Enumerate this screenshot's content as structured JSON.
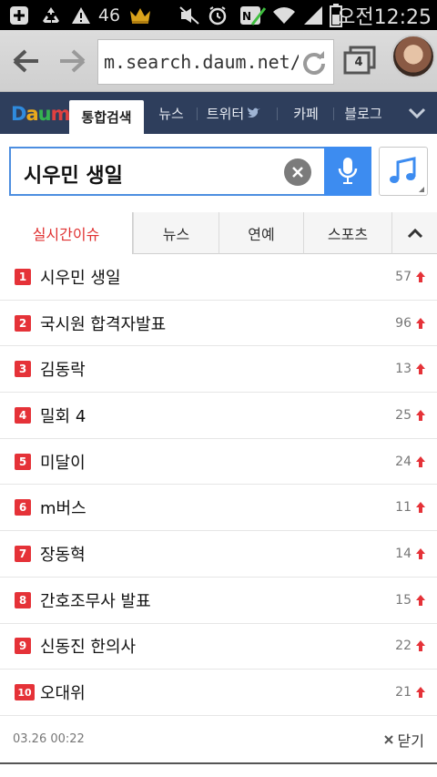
{
  "status_bar": {
    "signal_number": "46",
    "time": "오전12:25"
  },
  "browser": {
    "url": "m.search.daum.net/se",
    "tab_count": "4"
  },
  "daum_nav": {
    "logo": "Daum",
    "tabs": [
      "통합검색",
      "뉴스",
      "트위터",
      "카페",
      "블로그"
    ]
  },
  "search": {
    "query": "시우민 생일"
  },
  "issue_tabs": [
    "실시간이슈",
    "뉴스",
    "연예",
    "스포츠"
  ],
  "ranking": [
    {
      "rank": "1",
      "term": "시우민 생일",
      "count": "57"
    },
    {
      "rank": "2",
      "term": "국시원 합격자발표",
      "count": "96"
    },
    {
      "rank": "3",
      "term": "김동락",
      "count": "13"
    },
    {
      "rank": "4",
      "term": "밀회 4",
      "count": "25"
    },
    {
      "rank": "5",
      "term": "미달이",
      "count": "24"
    },
    {
      "rank": "6",
      "term": "m버스",
      "count": "11"
    },
    {
      "rank": "7",
      "term": "장동혁",
      "count": "14"
    },
    {
      "rank": "8",
      "term": "간호조무사 발표",
      "count": "15"
    },
    {
      "rank": "9",
      "term": "신동진 한의사",
      "count": "22"
    },
    {
      "rank": "10",
      "term": "오대위",
      "count": "21"
    }
  ],
  "footer": {
    "timestamp": "03.26 00:22",
    "close_label": "닫기"
  },
  "colors": {
    "accent_red": "#e53238",
    "daum_nav_bg": "#2e3e5c",
    "search_blue": "#3d8cf0"
  }
}
